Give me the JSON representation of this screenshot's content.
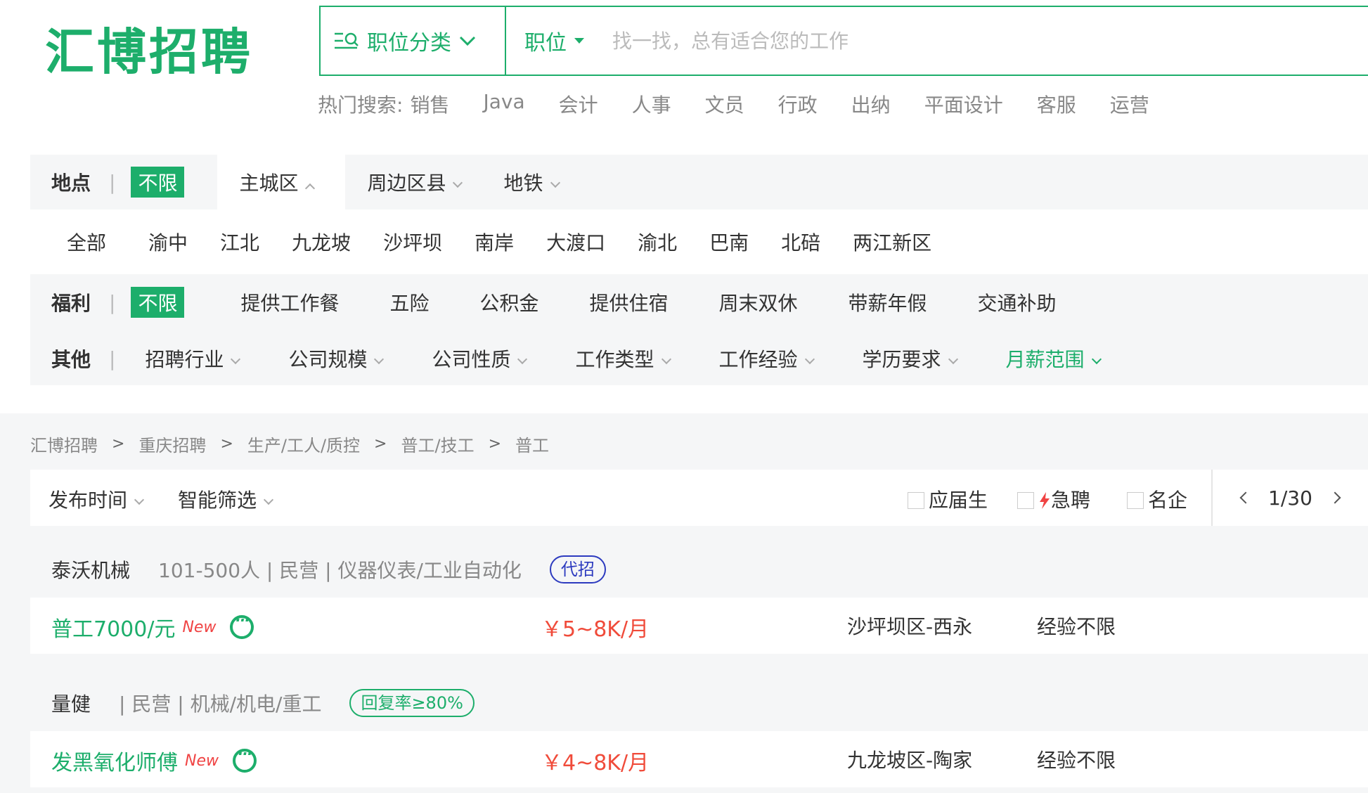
{
  "logo": "汇博招聘",
  "search": {
    "category_label": "职位分类",
    "field_label": "职位",
    "placeholder": "找一找，总有适合您的工作"
  },
  "hot_search": {
    "label": "热门搜索:",
    "items": [
      "销售",
      "Java",
      "会计",
      "人事",
      "文员",
      "行政",
      "出纳",
      "平面设计",
      "客服",
      "运营"
    ]
  },
  "filters": {
    "location": {
      "key": "地点",
      "active": "不限",
      "tabs": [
        "主城区",
        "周边区县",
        "地铁"
      ],
      "districts": [
        "全部",
        "渝中",
        "江北",
        "九龙坡",
        "沙坪坝",
        "南岸",
        "大渡口",
        "渝北",
        "巴南",
        "北碚",
        "两江新区"
      ]
    },
    "welfare": {
      "key": "福利",
      "active": "不限",
      "items": [
        "提供工作餐",
        "五险",
        "公积金",
        "提供住宿",
        "周末双休",
        "带薪年假",
        "交通补助"
      ]
    },
    "other": {
      "key": "其他",
      "items": [
        "招聘行业",
        "公司规模",
        "公司性质",
        "工作类型",
        "工作经验",
        "学历要求",
        "月薪范围"
      ]
    }
  },
  "breadcrumb": [
    "汇博招聘",
    "重庆招聘",
    "生产/工人/质控",
    "普工/技工",
    "普工"
  ],
  "sortbar": {
    "publish_time": "发布时间",
    "smart_filter": "智能筛选",
    "fresh_grad": "应届生",
    "urgent": "急聘",
    "famous": "名企",
    "page": "1/30"
  },
  "jobs": [
    {
      "company": "泰沃机械",
      "meta": "101-500人 | 民营 | 仪器仪表/工业自动化",
      "badge": "代招",
      "title": "普工7000/元",
      "new": "New",
      "salary": "￥5~8K/月",
      "area": "沙坪坝区-西永",
      "experience": "经验不限"
    },
    {
      "company": "量健",
      "meta": "| 民营 | 机械/机电/重工",
      "badge": "回复率≥80%",
      "title": "发黑氧化师傅",
      "new": "New",
      "salary": "￥4~8K/月",
      "area": "九龙坡区-陶家",
      "experience": "经验不限"
    }
  ]
}
